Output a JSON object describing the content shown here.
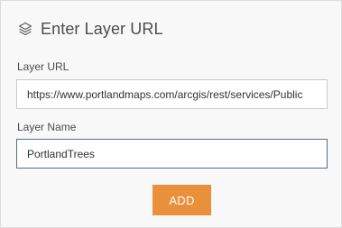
{
  "header": {
    "icon": "layers-icon",
    "title": "Enter Layer URL"
  },
  "fields": {
    "url": {
      "label": "Layer URL",
      "value": "https://www.portlandmaps.com/arcgis/rest/services/Public"
    },
    "name": {
      "label": "Layer Name",
      "value": "PortlandTrees"
    }
  },
  "add_button": {
    "label": "ADD",
    "color": "#e8913a"
  }
}
